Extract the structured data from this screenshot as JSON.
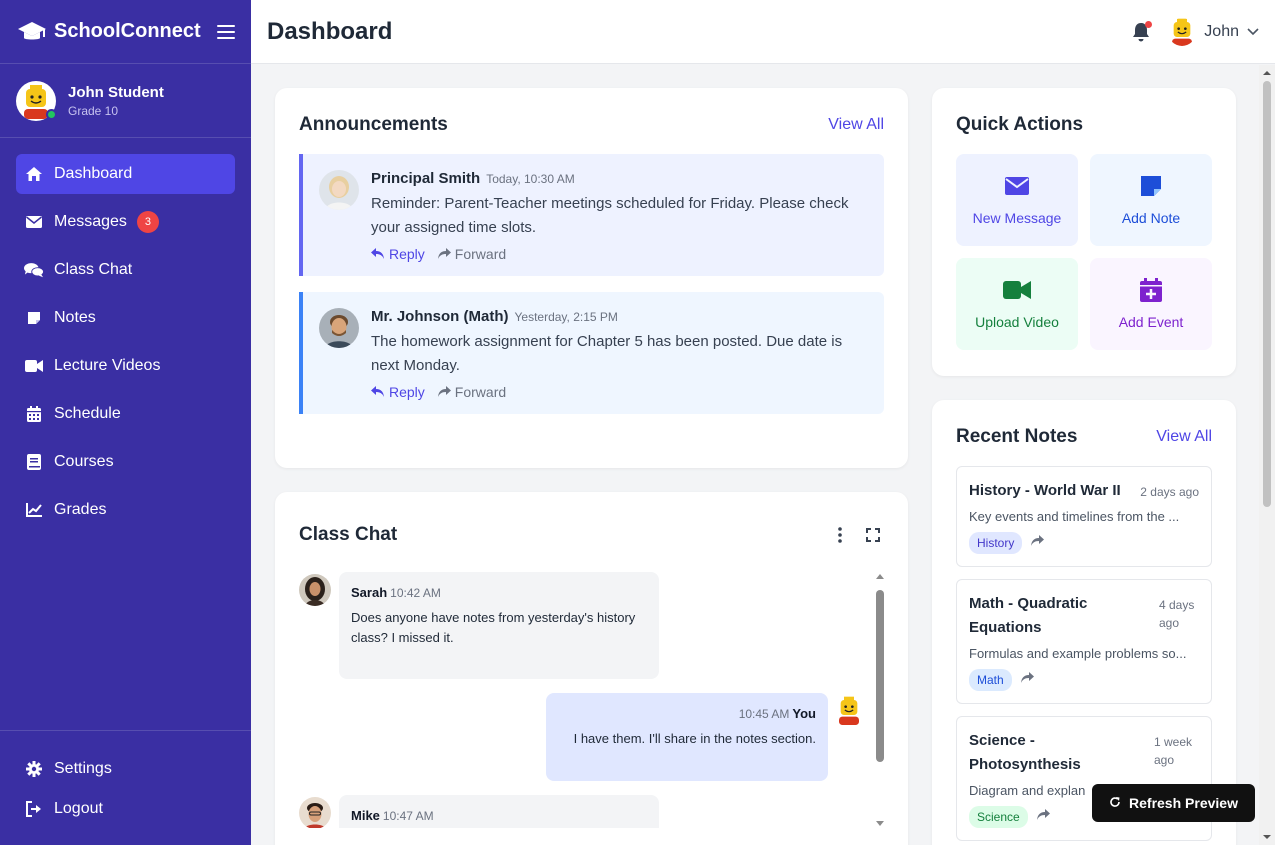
{
  "app": {
    "name": "SchoolConnect"
  },
  "user": {
    "name": "John Student",
    "grade": "Grade 10",
    "short_name": "John"
  },
  "sidebar": {
    "items": [
      {
        "label": "Dashboard",
        "icon": "home-icon"
      },
      {
        "label": "Messages",
        "icon": "envelope-icon",
        "badge": "3"
      },
      {
        "label": "Class Chat",
        "icon": "chat-bubbles-icon"
      },
      {
        "label": "Notes",
        "icon": "note-icon"
      },
      {
        "label": "Lecture Videos",
        "icon": "video-camera-icon"
      },
      {
        "label": "Schedule",
        "icon": "calendar-icon"
      },
      {
        "label": "Courses",
        "icon": "book-icon"
      },
      {
        "label": "Grades",
        "icon": "chart-line-icon"
      }
    ],
    "bottom": [
      {
        "label": "Settings",
        "icon": "gear-icon"
      },
      {
        "label": "Logout",
        "icon": "logout-icon"
      }
    ]
  },
  "header": {
    "title": "Dashboard"
  },
  "announcements": {
    "title": "Announcements",
    "view_all": "View All",
    "items": [
      {
        "author": "Principal Smith",
        "time": "Today, 10:30 AM",
        "text": "Reminder: Parent-Teacher meetings scheduled for Friday. Please check your assigned time slots.",
        "reply": "Reply",
        "forward": "Forward"
      },
      {
        "author": "Mr. Johnson (Math)",
        "time": "Yesterday, 2:15 PM",
        "text": "The homework assignment for Chapter 5 has been posted. Due date is next Monday.",
        "reply": "Reply",
        "forward": "Forward"
      }
    ]
  },
  "chat": {
    "title": "Class Chat",
    "messages": [
      {
        "name": "Sarah",
        "time": "10:42 AM",
        "text": "Does anyone have notes from yesterday's history class? I missed it."
      },
      {
        "name": "You",
        "time": "10:45 AM",
        "text": "I have them. I'll share in the notes section."
      },
      {
        "name": "Mike",
        "time": "10:47 AM",
        "text": ""
      }
    ]
  },
  "quick_actions": {
    "title": "Quick Actions",
    "items": [
      {
        "label": "New Message",
        "icon": "envelope-icon",
        "bg": "#eef2ff",
        "color": "#4f46e5"
      },
      {
        "label": "Add Note",
        "icon": "sticky-note-icon",
        "bg": "#eff6ff",
        "color": "#1d4ed8"
      },
      {
        "label": "Upload Video",
        "icon": "video-camera-icon",
        "bg": "#ecfdf5",
        "color": "#15803d"
      },
      {
        "label": "Add Event",
        "icon": "calendar-plus-icon",
        "bg": "#faf5ff",
        "color": "#7e22ce"
      }
    ]
  },
  "notes": {
    "title": "Recent Notes",
    "view_all": "View All",
    "items": [
      {
        "title": "History - World War II",
        "date": "2 days ago",
        "desc": "Key events and timelines from the ...",
        "tag": "History"
      },
      {
        "title": "Math - Quadratic Equations",
        "date": "4 days ago",
        "desc": "Formulas and example problems so...",
        "tag": "Math"
      },
      {
        "title": "Science - Photosynthesis",
        "date": "1 week ago",
        "desc": "Diagram and explan",
        "tag": "Science"
      }
    ]
  },
  "refresh": {
    "label": "Refresh Preview"
  },
  "colors": {
    "sidebar": "#3a2fa3",
    "accent": "#4f46e5",
    "badge": "#ef4444"
  }
}
